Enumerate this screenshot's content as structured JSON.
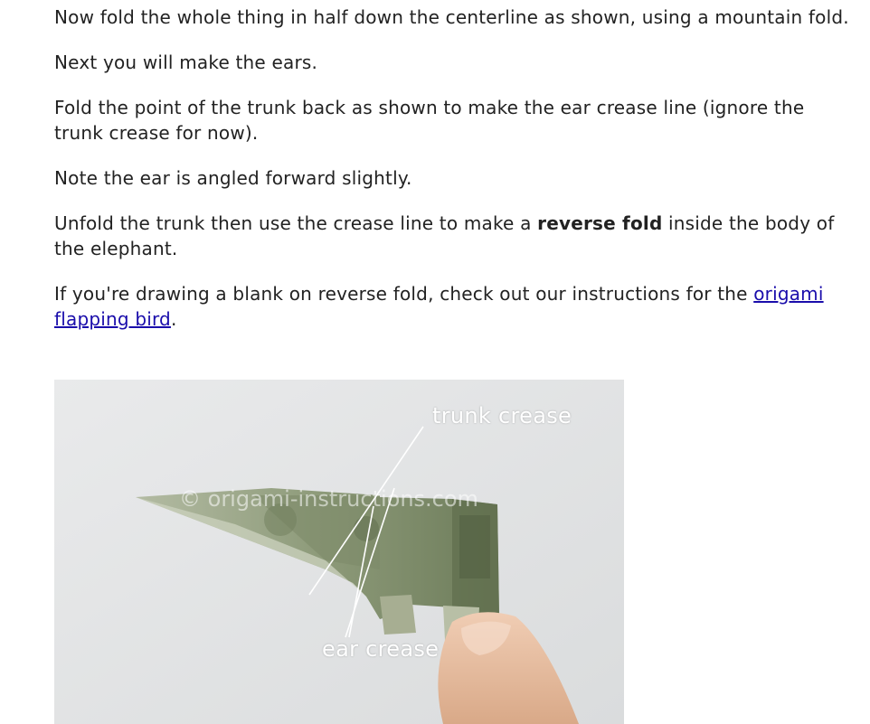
{
  "paragraphs": {
    "p1": "Now fold the whole thing in half down the centerline as shown, using a mountain fold.",
    "p2": "Next you will make the ears.",
    "p3": "Fold the point of the trunk back as shown to make the ear crease line (ignore the trunk crease for now).",
    "p4": "Note the ear is angled forward slightly.",
    "p5_before": "Unfold the trunk then use the crease line to make a ",
    "p5_bold": "reverse fold",
    "p5_after": " inside the body of the elephant.",
    "p6_before": "If you're drawing a blank on reverse fold, check out our instructions for the ",
    "p6_link": "origami flapping bird",
    "p6_after": "."
  },
  "photo": {
    "label_trunk": "trunk crease",
    "label_ear": "ear crease",
    "watermark": "© origami-instructions.com",
    "colors": {
      "background": "#e4e5e6",
      "bill": "#8f9c7c",
      "bill_dark": "#5d6b4c",
      "finger": "#e9c2a6"
    }
  }
}
